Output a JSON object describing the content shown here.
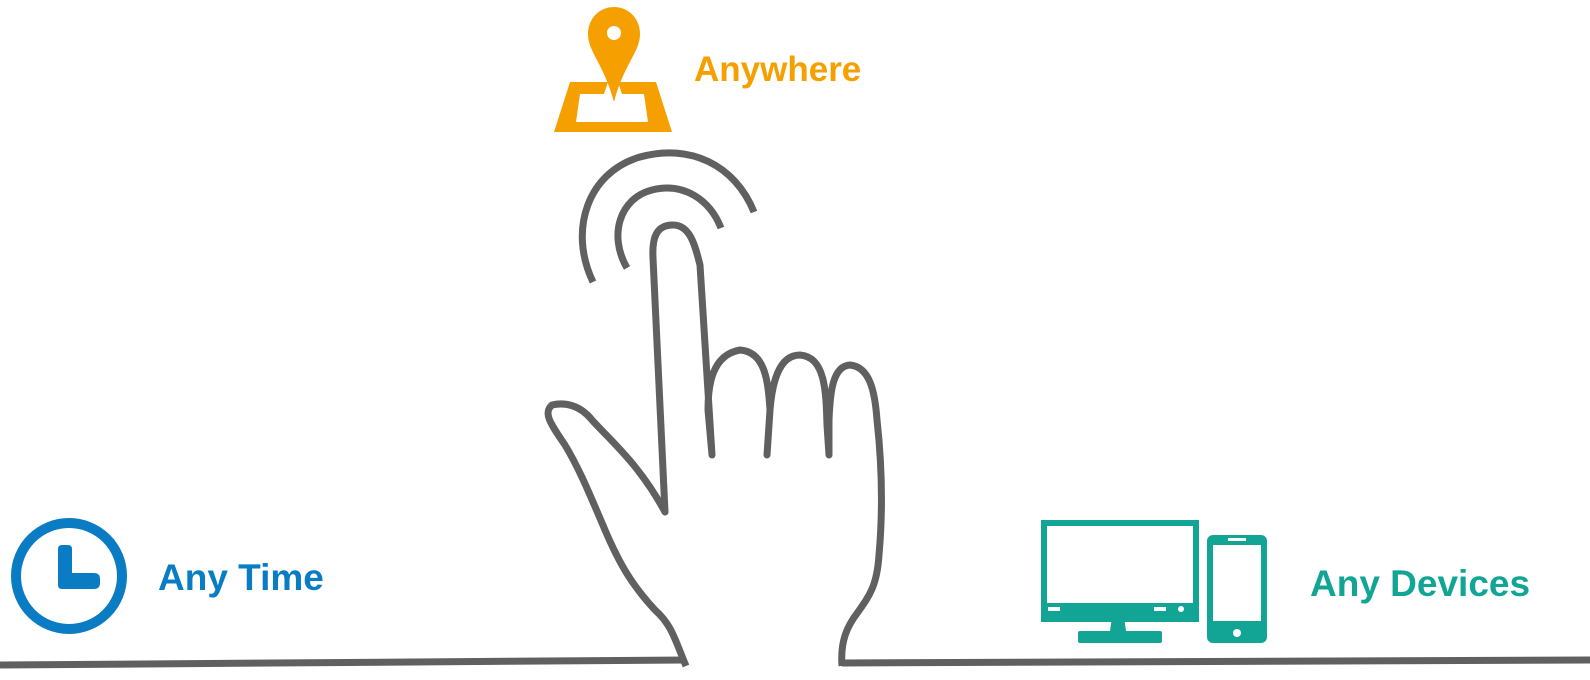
{
  "colors": {
    "anywhere": "#F5A000",
    "any_time": "#0A7CC4",
    "any_devices": "#12A596",
    "line": "#606060"
  },
  "features": {
    "anywhere": {
      "label": "Anywhere",
      "icon": "location-pin-map-icon"
    },
    "any_time": {
      "label": "Any Time",
      "icon": "clock-icon"
    },
    "any_devices": {
      "label": "Any Devices",
      "icon": "desktop-and-phone-icon"
    }
  },
  "illustration": {
    "icon": "hand-tap-gesture-icon"
  }
}
